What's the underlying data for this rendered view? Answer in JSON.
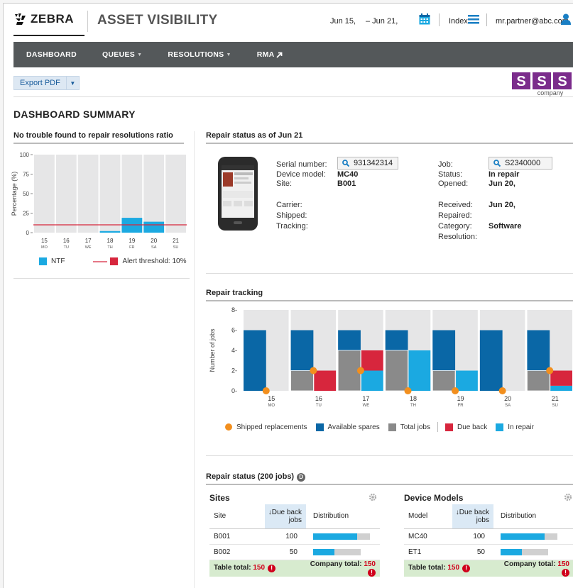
{
  "header": {
    "brand": "ZEBRA",
    "app_title": "ASSET VISIBILITY",
    "date_from": "Jun 15,",
    "date_to": "– Jun 21,",
    "index_label": "Index",
    "user_email": "mr.partner@abc.com"
  },
  "nav": {
    "items": [
      "DASHBOARD",
      "QUEUES",
      "RESOLUTIONS",
      "RMA"
    ]
  },
  "toolbar": {
    "export_label": "Export PDF",
    "company_logo_text": "company"
  },
  "page_title": "DASHBOARD SUMMARY",
  "ntf_panel": {
    "title": "No trouble found to repair resolutions ratio",
    "legend_ntf": "NTF",
    "legend_alert": "Alert threshold: 10%"
  },
  "repair_status": {
    "title": "Repair status as of Jun 21",
    "serial_label": "Serial number:",
    "serial_value": "931342314",
    "model_label": "Device model:",
    "model_value": "MC40",
    "site_label": "Site:",
    "site_value": "B001",
    "carrier_label": "Carrier:",
    "shipped_label": "Shipped:",
    "tracking_label": "Tracking:",
    "job_label": "Job:",
    "job_value": "S2340000",
    "status_label": "Status:",
    "status_value": "In repair",
    "opened_label": "Opened:",
    "opened_value": "Jun 20,",
    "received_label": "Received:",
    "received_value": "Jun 20,",
    "repaired_label": "Repaired:",
    "category_label": "Category:",
    "category_value": "Software",
    "resolution_label": "Resolution:"
  },
  "tracking_panel": {
    "title": "Repair tracking",
    "legend": {
      "shipped": "Shipped replacements",
      "available": "Available spares",
      "total": "Total jobs",
      "due_back": "Due back",
      "in_repair": "In repair"
    }
  },
  "repair_summary": {
    "title": "Repair status (200 jobs)",
    "d_badge": "D",
    "sites": {
      "title": "Sites",
      "col_site": "Site",
      "col_due_1": "Due back",
      "col_due_2": "jobs",
      "col_dist": "Distribution",
      "rows": [
        {
          "name": "B001",
          "value": "100",
          "dist": 0.67
        },
        {
          "name": "B002",
          "value": "50",
          "dist": 0.33
        }
      ],
      "table_total_label": "Table total:",
      "table_total_value": "150",
      "company_total_label": "Company total:",
      "company_total_value": "150"
    },
    "models": {
      "title": "Device Models",
      "col_model": "Model",
      "col_due_1": "Due back",
      "col_due_2": "jobs",
      "col_dist": "Distribution",
      "rows": [
        {
          "name": "MC40",
          "value": "100",
          "dist": 0.67
        },
        {
          "name": "ET1",
          "value": "50",
          "dist": 0.33
        }
      ],
      "table_total_label": "Table total:",
      "table_total_value": "150",
      "company_total_label": "Company total:",
      "company_total_value": "150"
    }
  },
  "colors": {
    "nav_bg": "#54585a",
    "ntf_blue": "#1ba9e1",
    "alert_red": "#d7263d",
    "available_blue": "#0a67a6",
    "total_gray": "#8a8a8a",
    "due_red": "#d7263d",
    "in_repair_cyan": "#1ba9e1",
    "shipped_orange": "#f28f1e"
  },
  "chart_data": [
    {
      "type": "bar",
      "ylabel": "Percentage (%)",
      "ylim": [
        0,
        100
      ],
      "yticks": [
        0,
        25,
        50,
        75,
        100
      ],
      "categories": [
        "15",
        "16",
        "17",
        "18",
        "19",
        "20",
        "21"
      ],
      "category_days": [
        "MO",
        "TU",
        "WE",
        "TH",
        "FR",
        "SA",
        "SU"
      ],
      "series": [
        {
          "name": "NTF",
          "values": [
            0,
            0,
            0,
            2,
            19,
            14,
            0
          ]
        }
      ],
      "threshold": 10,
      "grid": true
    },
    {
      "type": "bar",
      "ylabel": "Number of jobs",
      "ylim": [
        0,
        8
      ],
      "yticks": [
        0,
        2,
        4,
        6,
        8
      ],
      "categories": [
        "15",
        "16",
        "17",
        "18",
        "19",
        "20",
        "21"
      ],
      "category_days": [
        "MO",
        "TU",
        "WE",
        "TH",
        "FR",
        "SA",
        "SU"
      ],
      "series": [
        {
          "name": "Available spares",
          "values": [
            6,
            6,
            6,
            6,
            6,
            6,
            6
          ]
        },
        {
          "name": "Total jobs",
          "values": [
            0,
            2,
            4,
            4,
            2,
            0,
            2
          ]
        },
        {
          "name": "Due back",
          "values": [
            0,
            2,
            4,
            0,
            0,
            0,
            2
          ]
        },
        {
          "name": "In repair",
          "values": [
            0,
            0,
            2,
            4,
            2,
            0,
            0.5
          ]
        },
        {
          "name": "Shipped replacements",
          "values": [
            0,
            2,
            2,
            0,
            0,
            0,
            2
          ]
        }
      ]
    }
  ]
}
